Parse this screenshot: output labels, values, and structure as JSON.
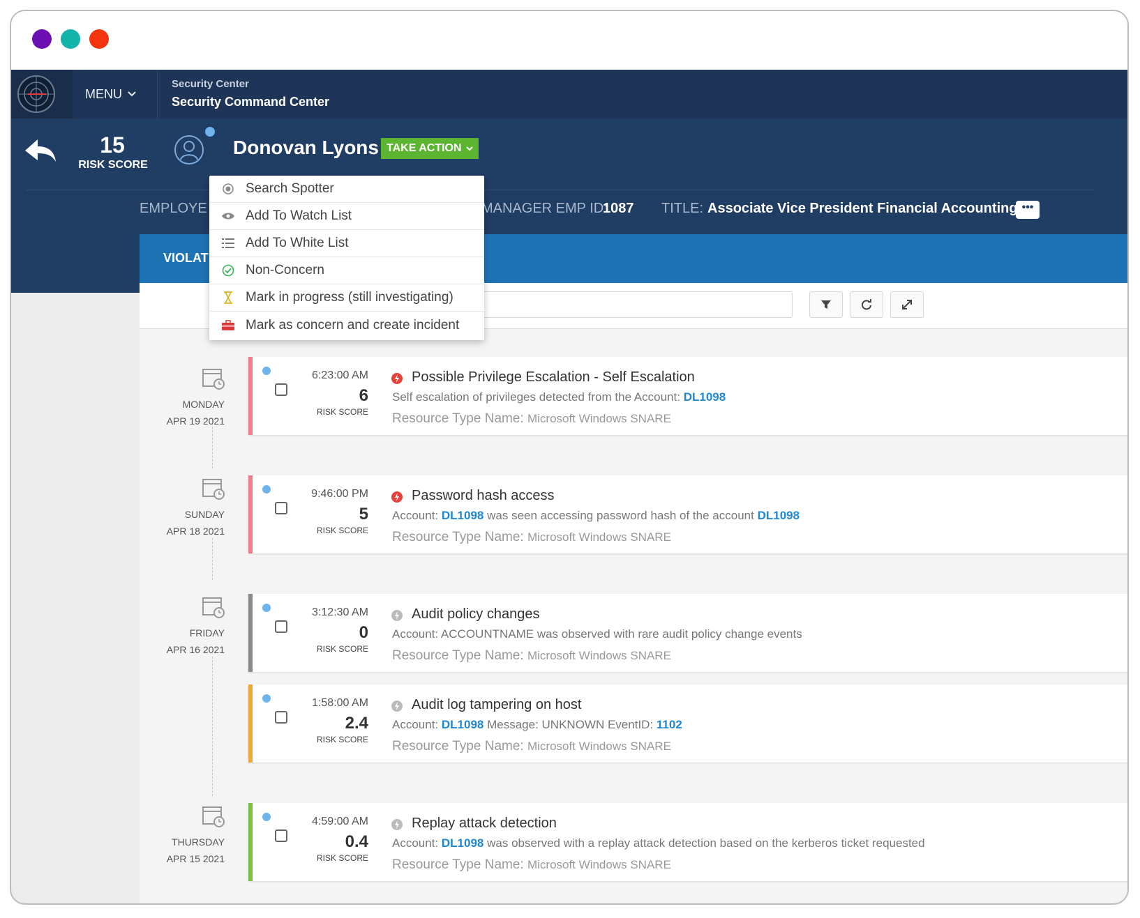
{
  "window_controls": [
    "close",
    "minimize",
    "maximize"
  ],
  "nav": {
    "menu_label": "MENU",
    "crumb_parent": "Security Center",
    "crumb_current": "Security Command Center"
  },
  "profile": {
    "risk_score": "15",
    "risk_score_label": "RISK SCORE",
    "name": "Donovan Lyons",
    "take_action_label": "TAKE ACTION",
    "employee_label": "EMPLOYE",
    "manager_label": "MANAGER EMP ID:",
    "manager_value": "1087",
    "title_label": "TITLE:",
    "title_value": "Associate Vice President Financial Accounting",
    "more_label": "•••"
  },
  "tabs": {
    "violations_label": "VIOLAT"
  },
  "take_action_menu": [
    {
      "label": "Search Spotter",
      "icon": "target-icon"
    },
    {
      "label": "Add To Watch List",
      "icon": "eye-icon"
    },
    {
      "label": "Add To White List",
      "icon": "list-icon"
    },
    {
      "label": "Non-Concern",
      "icon": "check-circle-icon"
    },
    {
      "label": "Mark in progress (still investigating)",
      "icon": "hourglass-icon"
    },
    {
      "label": "Mark as concern and create incident",
      "icon": "briefcase-icon"
    }
  ],
  "days": [
    {
      "day": "MONDAY",
      "date": "APR 19 2021"
    },
    {
      "day": "SUNDAY",
      "date": "APR 18 2021"
    },
    {
      "day": "FRIDAY",
      "date": "APR 16 2021"
    },
    {
      "day": "THURSDAY",
      "date": "APR 15 2021"
    }
  ],
  "violations": [
    {
      "time": "6:23:00 AM",
      "score": "6",
      "score_label": "RISK SCORE",
      "severity": "high",
      "accent": "#f07f8c",
      "title": "Possible Privilege Escalation - Self Escalation",
      "desc_a": "Self escalation of privileges detected from the Account:",
      "acct_1": "DL1098",
      "desc_b": "",
      "acct_2": "",
      "res_label": "Resource Type Name:",
      "res_value": "Microsoft Windows SNARE"
    },
    {
      "time": "9:46:00 PM",
      "score": "5",
      "score_label": "RISK SCORE",
      "severity": "high",
      "accent": "#f07f8c",
      "title": "Password hash access",
      "desc_a": "Account:",
      "acct_1": "DL1098",
      "desc_b": "was seen accessing password hash of the account",
      "acct_2": "DL1098",
      "res_label": "Resource Type Name:",
      "res_value": "Microsoft Windows SNARE"
    },
    {
      "time": "3:12:30 AM",
      "score": "0",
      "score_label": "RISK SCORE",
      "severity": "none",
      "accent": "#8a8a8a",
      "title": "Audit policy changes",
      "desc_a": "Account: ACCOUNTNAME was observed with rare audit policy change events",
      "acct_1": "",
      "desc_b": "",
      "acct_2": "",
      "res_label": "Resource Type Name:",
      "res_value": "Microsoft Windows SNARE"
    },
    {
      "time": "1:58:00 AM",
      "score": "2.4",
      "score_label": "RISK SCORE",
      "severity": "low",
      "accent": "#f2a93b",
      "title": "Audit log tampering on host",
      "desc_a": "Account:",
      "acct_1": "DL1098",
      "desc_b": "Message: UNKNOWN EventID:",
      "acct_2": "1102",
      "res_label": "Resource Type Name:",
      "res_value": "Microsoft Windows SNARE"
    },
    {
      "time": "4:59:00 AM",
      "score": "0.4",
      "score_label": "RISK SCORE",
      "severity": "low",
      "accent": "#7cc143",
      "title": "Replay attack detection",
      "desc_a": "Account:",
      "acct_1": "DL1098",
      "desc_b": "was observed with a replay attack detection based on the kerberos ticket requested",
      "acct_2": "",
      "res_label": "Resource Type Name:",
      "res_value": "Microsoft Windows SNARE"
    }
  ],
  "colors": {
    "nav_bg": "#1e3557",
    "header_bg": "#203d63",
    "tab_bg": "#1e73b4",
    "take_action": "#5cb531",
    "link": "#1e88d6",
    "severity_high": "#e8413a",
    "severity_none": "#bbbbbb"
  }
}
